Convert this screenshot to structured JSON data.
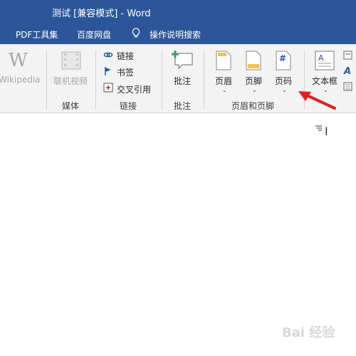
{
  "window": {
    "title": "测试 [兼容模式]  -  Word"
  },
  "menubar": {
    "items": [
      "PDF工具集",
      "百度网盘",
      "操作说明搜索"
    ]
  },
  "ribbon": {
    "wikipedia_label": "Wikipedia",
    "online_video_label": "联机视频",
    "link_label": "链接",
    "bookmark_label": "书签",
    "cross_ref_label": "交叉引用",
    "comment_label": "批注",
    "header_label": "页眉",
    "footer_label": "页脚",
    "page_number_label": "页码",
    "page_number_icon_text": "#",
    "textbox_label": "文本框",
    "groups": {
      "media": "媒体",
      "links": "链接",
      "comments": "批注",
      "header_footer": "页眉和页脚"
    }
  },
  "doc": {
    "cursor": "I",
    "watermark": "Bai 经验"
  },
  "colors": {
    "titlebar": "#2b579a",
    "ribbon": "#f3f3f3",
    "arrow": "#e02020"
  }
}
